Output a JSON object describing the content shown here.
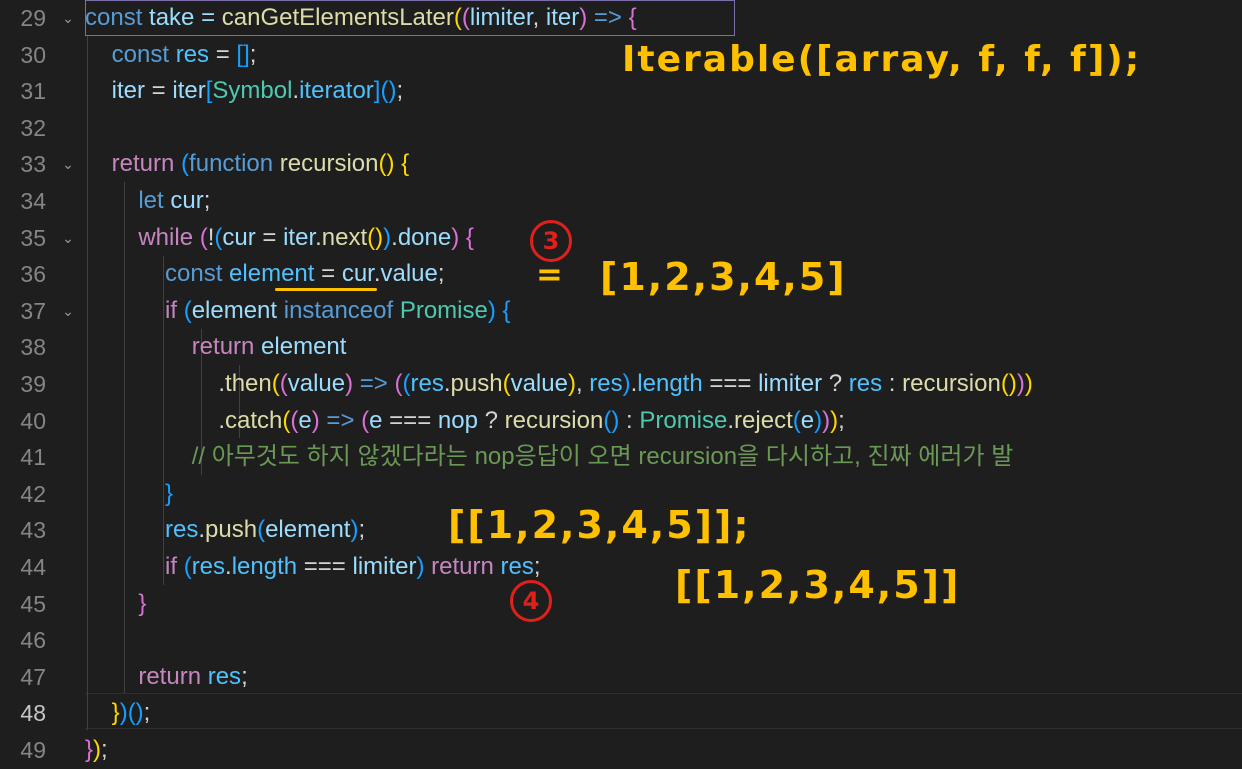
{
  "editor": {
    "lines": [
      {
        "num": "29",
        "tokens": [
          {
            "text": "const",
            "cls": "k"
          },
          {
            "text": " take = ",
            "cls": "v"
          },
          {
            "text": "canGetElementsLater",
            "cls": "f"
          },
          {
            "text": "(",
            "cls": "y"
          },
          {
            "text": "(",
            "cls": "p"
          },
          {
            "text": "limiter",
            "cls": "v"
          },
          {
            "text": ", ",
            "cls": ""
          },
          {
            "text": "iter",
            "cls": "v"
          },
          {
            "text": ")",
            "cls": "p"
          },
          {
            "text": " => ",
            "cls": "k"
          },
          {
            "text": "{",
            "cls": "p"
          }
        ]
      },
      {
        "num": "30",
        "tokens": [
          {
            "text": "    ",
            "cls": ""
          },
          {
            "text": "const",
            "cls": "k"
          },
          {
            "text": " res",
            "cls": "n"
          },
          {
            "text": " = ",
            "cls": ""
          },
          {
            "text": "[]",
            "cls": "bl"
          },
          {
            "text": ";",
            "cls": ""
          }
        ]
      },
      {
        "num": "31",
        "tokens": [
          {
            "text": "    ",
            "cls": ""
          },
          {
            "text": "iter",
            "cls": "v"
          },
          {
            "text": " = ",
            "cls": ""
          },
          {
            "text": "iter",
            "cls": "v"
          },
          {
            "text": "[",
            "cls": "bl"
          },
          {
            "text": "Symbol",
            "cls": "t"
          },
          {
            "text": ".",
            "cls": ""
          },
          {
            "text": "iterator",
            "cls": "n"
          },
          {
            "text": "]",
            "cls": "bl"
          },
          {
            "text": "()",
            "cls": "bl"
          },
          {
            "text": ";",
            "cls": ""
          }
        ]
      },
      {
        "num": "32",
        "tokens": []
      },
      {
        "num": "33",
        "tokens": [
          {
            "text": "    ",
            "cls": ""
          },
          {
            "text": "return",
            "cls": "c"
          },
          {
            "text": " ",
            "cls": ""
          },
          {
            "text": "(",
            "cls": "bl"
          },
          {
            "text": "function",
            "cls": "k"
          },
          {
            "text": " ",
            "cls": ""
          },
          {
            "text": "recursion",
            "cls": "f"
          },
          {
            "text": "()",
            "cls": "y"
          },
          {
            "text": " {",
            "cls": "y"
          }
        ]
      },
      {
        "num": "34",
        "tokens": [
          {
            "text": "        ",
            "cls": ""
          },
          {
            "text": "let",
            "cls": "k"
          },
          {
            "text": " cur",
            "cls": "v"
          },
          {
            "text": ";",
            "cls": ""
          }
        ]
      },
      {
        "num": "35",
        "tokens": [
          {
            "text": "        ",
            "cls": ""
          },
          {
            "text": "while",
            "cls": "c"
          },
          {
            "text": " ",
            "cls": ""
          },
          {
            "text": "(",
            "cls": "p"
          },
          {
            "text": "!",
            "cls": ""
          },
          {
            "text": "(",
            "cls": "bl"
          },
          {
            "text": "cur",
            "cls": "v"
          },
          {
            "text": " = ",
            "cls": ""
          },
          {
            "text": "iter",
            "cls": "v"
          },
          {
            "text": ".",
            "cls": ""
          },
          {
            "text": "next",
            "cls": "f"
          },
          {
            "text": "()",
            "cls": "y"
          },
          {
            "text": ")",
            "cls": "bl"
          },
          {
            "text": ".",
            "cls": ""
          },
          {
            "text": "done",
            "cls": "v"
          },
          {
            "text": ")",
            "cls": "p"
          },
          {
            "text": " {",
            "cls": "p"
          }
        ]
      },
      {
        "num": "36",
        "tokens": [
          {
            "text": "            ",
            "cls": ""
          },
          {
            "text": "const",
            "cls": "k"
          },
          {
            "text": " element",
            "cls": "n"
          },
          {
            "text": " = ",
            "cls": ""
          },
          {
            "text": "cur",
            "cls": "v"
          },
          {
            "text": ".",
            "cls": ""
          },
          {
            "text": "value",
            "cls": "v"
          },
          {
            "text": ";",
            "cls": ""
          }
        ]
      },
      {
        "num": "37",
        "tokens": [
          {
            "text": "            ",
            "cls": ""
          },
          {
            "text": "if",
            "cls": "c"
          },
          {
            "text": " ",
            "cls": ""
          },
          {
            "text": "(",
            "cls": "bl"
          },
          {
            "text": "element",
            "cls": "v"
          },
          {
            "text": " instanceof ",
            "cls": "k"
          },
          {
            "text": "Promise",
            "cls": "t"
          },
          {
            "text": ")",
            "cls": "bl"
          },
          {
            "text": " {",
            "cls": "bl"
          }
        ]
      },
      {
        "num": "38",
        "tokens": [
          {
            "text": "                ",
            "cls": ""
          },
          {
            "text": "return",
            "cls": "c"
          },
          {
            "text": " element",
            "cls": "v"
          }
        ]
      },
      {
        "num": "39",
        "tokens": [
          {
            "text": "                    ",
            "cls": ""
          },
          {
            "text": ".",
            "cls": ""
          },
          {
            "text": "then",
            "cls": "f"
          },
          {
            "text": "(",
            "cls": "y"
          },
          {
            "text": "(",
            "cls": "p"
          },
          {
            "text": "value",
            "cls": "v"
          },
          {
            "text": ")",
            "cls": "p"
          },
          {
            "text": " => ",
            "cls": "k"
          },
          {
            "text": "(",
            "cls": "p"
          },
          {
            "text": "(",
            "cls": "bl"
          },
          {
            "text": "res",
            "cls": "n"
          },
          {
            "text": ".",
            "cls": ""
          },
          {
            "text": "push",
            "cls": "f"
          },
          {
            "text": "(",
            "cls": "y"
          },
          {
            "text": "value",
            "cls": "v"
          },
          {
            "text": ")",
            "cls": "y"
          },
          {
            "text": ", ",
            "cls": ""
          },
          {
            "text": "res",
            "cls": "n"
          },
          {
            "text": ")",
            "cls": "bl"
          },
          {
            "text": ".",
            "cls": ""
          },
          {
            "text": "length",
            "cls": "n"
          },
          {
            "text": " === ",
            "cls": ""
          },
          {
            "text": "limiter",
            "cls": "v"
          },
          {
            "text": " ? ",
            "cls": ""
          },
          {
            "text": "res",
            "cls": "n"
          },
          {
            "text": " : ",
            "cls": ""
          },
          {
            "text": "recursion",
            "cls": "f"
          },
          {
            "text": "()",
            "cls": "y"
          },
          {
            "text": ")",
            "cls": "p"
          },
          {
            "text": ")",
            "cls": "y"
          }
        ]
      },
      {
        "num": "40",
        "tokens": [
          {
            "text": "                    ",
            "cls": ""
          },
          {
            "text": ".",
            "cls": ""
          },
          {
            "text": "catch",
            "cls": "f"
          },
          {
            "text": "(",
            "cls": "y"
          },
          {
            "text": "(",
            "cls": "p"
          },
          {
            "text": "e",
            "cls": "v"
          },
          {
            "text": ")",
            "cls": "p"
          },
          {
            "text": " => ",
            "cls": "k"
          },
          {
            "text": "(",
            "cls": "p"
          },
          {
            "text": "e",
            "cls": "v"
          },
          {
            "text": " === ",
            "cls": ""
          },
          {
            "text": "nop",
            "cls": "v"
          },
          {
            "text": " ? ",
            "cls": ""
          },
          {
            "text": "recursion",
            "cls": "f"
          },
          {
            "text": "()",
            "cls": "bl"
          },
          {
            "text": " : ",
            "cls": ""
          },
          {
            "text": "Promise",
            "cls": "t"
          },
          {
            "text": ".",
            "cls": ""
          },
          {
            "text": "reject",
            "cls": "f"
          },
          {
            "text": "(",
            "cls": "bl"
          },
          {
            "text": "e",
            "cls": "v"
          },
          {
            "text": ")",
            "cls": "bl"
          },
          {
            "text": ")",
            "cls": "p"
          },
          {
            "text": ")",
            "cls": "y"
          },
          {
            "text": ";",
            "cls": ""
          }
        ]
      },
      {
        "num": "41",
        "tokens": [
          {
            "text": "                ",
            "cls": ""
          },
          {
            "text": "// 아무것도 하지 않겠다라는 nop응답이 오면 recursion을 다시하고, 진짜 에러가 발",
            "cls": "cm"
          }
        ]
      },
      {
        "num": "42",
        "tokens": [
          {
            "text": "            ",
            "cls": ""
          },
          {
            "text": "}",
            "cls": "bl"
          }
        ]
      },
      {
        "num": "43",
        "tokens": [
          {
            "text": "            ",
            "cls": ""
          },
          {
            "text": "res",
            "cls": "n"
          },
          {
            "text": ".",
            "cls": ""
          },
          {
            "text": "push",
            "cls": "f"
          },
          {
            "text": "(",
            "cls": "bl"
          },
          {
            "text": "element",
            "cls": "v"
          },
          {
            "text": ")",
            "cls": "bl"
          },
          {
            "text": ";",
            "cls": ""
          }
        ]
      },
      {
        "num": "44",
        "tokens": [
          {
            "text": "            ",
            "cls": ""
          },
          {
            "text": "if",
            "cls": "c"
          },
          {
            "text": " ",
            "cls": ""
          },
          {
            "text": "(",
            "cls": "bl"
          },
          {
            "text": "res",
            "cls": "n"
          },
          {
            "text": ".",
            "cls": ""
          },
          {
            "text": "length",
            "cls": "n"
          },
          {
            "text": " === ",
            "cls": ""
          },
          {
            "text": "limiter",
            "cls": "v"
          },
          {
            "text": ")",
            "cls": "bl"
          },
          {
            "text": " return",
            "cls": "c"
          },
          {
            "text": " res",
            "cls": "n"
          },
          {
            "text": ";",
            "cls": ""
          }
        ]
      },
      {
        "num": "45",
        "tokens": [
          {
            "text": "        ",
            "cls": ""
          },
          {
            "text": "}",
            "cls": "p"
          }
        ]
      },
      {
        "num": "46",
        "tokens": []
      },
      {
        "num": "47",
        "tokens": [
          {
            "text": "        ",
            "cls": ""
          },
          {
            "text": "return",
            "cls": "c"
          },
          {
            "text": " res",
            "cls": "n"
          },
          {
            "text": ";",
            "cls": ""
          }
        ]
      },
      {
        "num": "48",
        "tokens": [
          {
            "text": "    ",
            "cls": ""
          },
          {
            "text": "}",
            "cls": "y"
          },
          {
            "text": ")",
            "cls": "bl"
          },
          {
            "text": "()",
            "cls": "bl"
          },
          {
            "text": ";",
            "cls": ""
          }
        ]
      },
      {
        "num": "49",
        "tokens": [
          {
            "text": "}",
            "cls": "p"
          },
          {
            "text": ")",
            "cls": "y"
          },
          {
            "text": ";",
            "cls": ""
          }
        ]
      }
    ]
  },
  "annotations": {
    "iterable_note": "Iterable([array, f, f, f]);",
    "step3": "3",
    "equals_mark": "=",
    "element_value": "[1,2,3,4,5]",
    "push_note": "[[1,2,3,4,5]];",
    "return_note": "[[1,2,3,4,5]]",
    "step4": "4"
  },
  "colors": {
    "background": "#1e1e1e",
    "annotation_yellow": "#ffc000",
    "annotation_red": "#e0211b"
  }
}
